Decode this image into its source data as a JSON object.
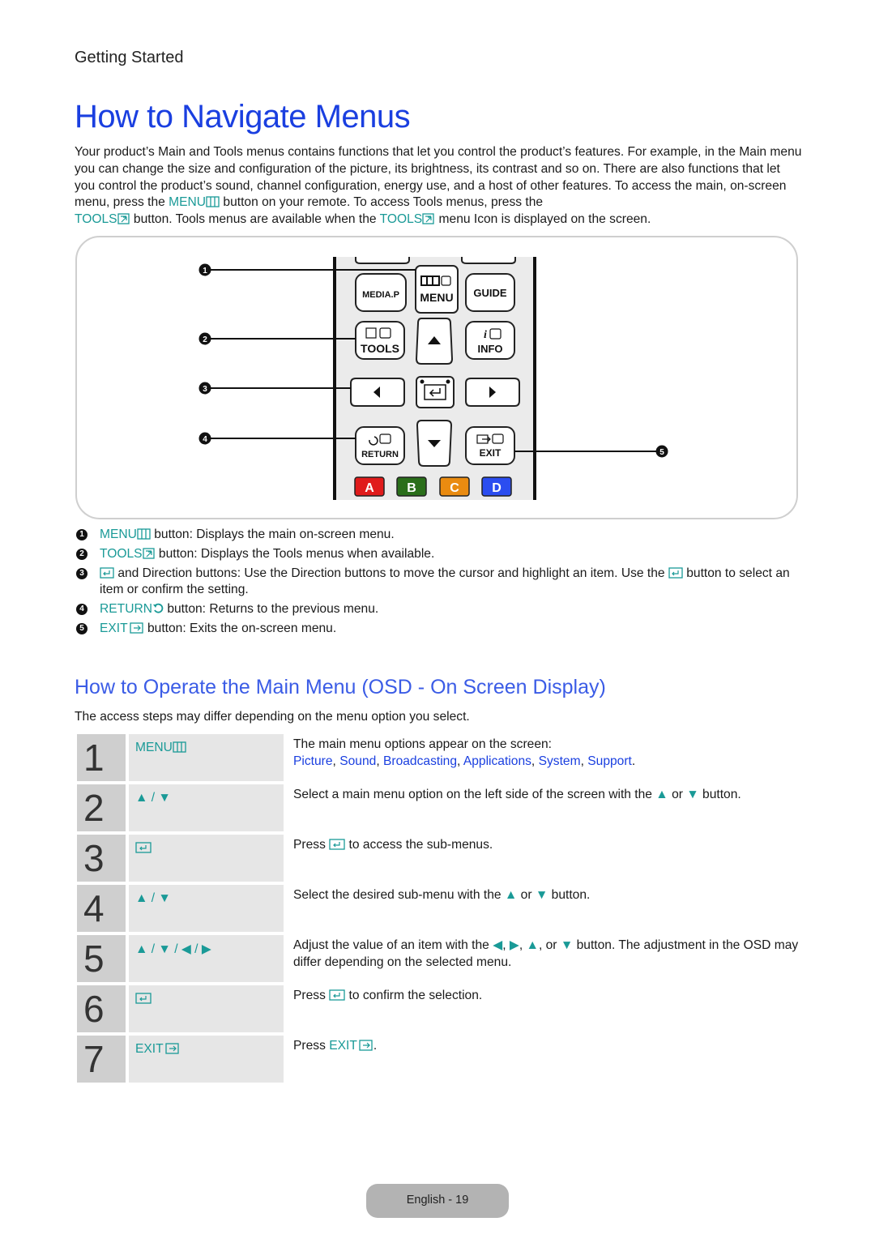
{
  "header": {
    "section": "Getting Started",
    "title": "How to Navigate Menus"
  },
  "intro": {
    "p1": "Your product’s Main and Tools menus contains functions that let you control the product’s features. For example, in the Main menu you can change the size and configuration of the picture, its brightness, its contrast and so on. There are also functions that let you control the product’s sound, channel configuration, energy use, and a host of other features. To access the main, on-screen menu, press the ",
    "menu_label": "MENU",
    "p2": " button on your remote. To access Tools menus, press the ",
    "tools_label": "TOOLS",
    "p3": " button. Tools menus are available when the ",
    "p4": " menu Icon is displayed on the screen."
  },
  "remote": {
    "buttons": {
      "media": "MEDIA.P",
      "menu": "MENU",
      "guide": "GUIDE",
      "tools": "TOOLS",
      "info": "INFO",
      "return": "RETURN",
      "exit": "EXIT",
      "a": "A",
      "b": "B",
      "c": "C",
      "d": "D"
    },
    "callout_numbers": [
      "1",
      "2",
      "3",
      "4",
      "5"
    ],
    "colors": {
      "a": "#e01b1b",
      "b": "#2a6e1a",
      "c": "#ea8b10",
      "d": "#2b4df0"
    }
  },
  "callouts": [
    {
      "num": "1",
      "label": "MENU",
      "text": " button: Displays the main on-screen menu."
    },
    {
      "num": "2",
      "label": "TOOLS",
      "text": " button: Displays the Tools menus when available."
    },
    {
      "num": "3",
      "text_a": " and Direction buttons: Use the Direction buttons to move the cursor and highlight an item. Use the ",
      "text_b": " button to select an item or confirm the setting."
    },
    {
      "num": "4",
      "label": "RETURN",
      "text": " button: Returns to the previous menu."
    },
    {
      "num": "5",
      "label": "EXIT",
      "text": " button: Exits the on-screen menu."
    }
  ],
  "osd": {
    "title": "How to Operate the Main Menu (OSD - On Screen Display)",
    "note": "The access steps may differ depending on the menu option you select.",
    "steps": [
      {
        "n": "1",
        "key": "MENU",
        "desc": "The main menu options appear on the screen:",
        "options": [
          "Picture",
          "Sound",
          "Broadcasting",
          "Applications",
          "System",
          "Support"
        ]
      },
      {
        "n": "2",
        "key": "▲ / ▼",
        "desc_a": "Select a main menu option on the left side of the screen with the ",
        "desc_b": " or ",
        "desc_c": " button."
      },
      {
        "n": "3",
        "desc_a": "Press ",
        "desc_b": " to access the sub-menus."
      },
      {
        "n": "4",
        "key": "▲ / ▼",
        "desc_a": "Select the desired sub-menu with the ",
        "desc_b": " or ",
        "desc_c": " button."
      },
      {
        "n": "5",
        "key": "▲ / ▼ / ◀ / ▶",
        "desc_a": "Adjust the value of an item with the ",
        "desc_b": " button. The adjustment in the OSD may differ depending on the selected menu."
      },
      {
        "n": "6",
        "desc_a": "Press ",
        "desc_b": " to confirm the selection."
      },
      {
        "n": "7",
        "key": "EXIT",
        "desc_a": "Press ",
        "desc_b": "EXIT",
        "desc_c": "."
      }
    ]
  },
  "footer": {
    "page": "English - 19"
  },
  "colors": {
    "title_blue": "#1a3fe0",
    "teal": "#1a9a97",
    "step_num_bg": "#cfcfcf",
    "step_key_bg": "#e6e6e6"
  }
}
